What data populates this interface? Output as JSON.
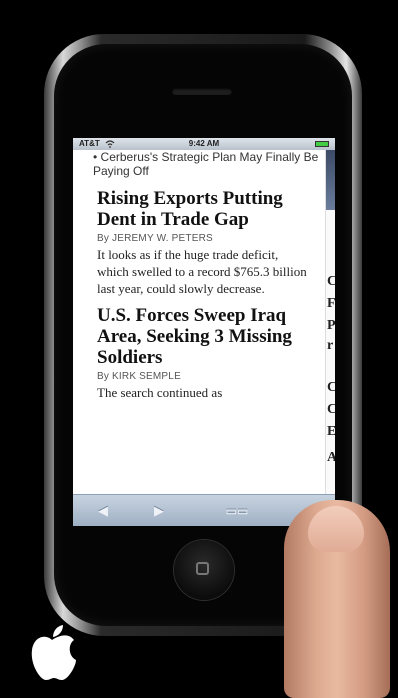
{
  "status_bar": {
    "carrier": "AT&T",
    "time": "9:42 AM"
  },
  "article_list": {
    "previous_link": "• Cerberus's Strategic Plan May Finally Be Paying Off",
    "articles": [
      {
        "headline": "Rising Exports Putting Dent in Trade Gap",
        "byline": "By JEREMY W. PETERS",
        "summary": "It looks as if the huge trade deficit, which swelled to a record $765.3 billion last year, could slowly decrease."
      },
      {
        "headline": "U.S. Forces Sweep Iraq Area, Seeking 3 Missing Soldiers",
        "byline": "By KIRK SEMPLE",
        "summary": "The search continued as"
      }
    ]
  },
  "side_column": {
    "letters": [
      "C",
      "F",
      "P",
      "r",
      "C",
      "C",
      "E",
      "A"
    ]
  },
  "toolbar": {
    "back_icon": "◀",
    "forward_icon": "▶",
    "bookmarks_icon": "▭▭"
  },
  "icons": {
    "wifi": "wifi-icon",
    "battery": "battery-icon",
    "apple_logo": "apple-logo-icon"
  },
  "colors": {
    "toolbar": "#a9b9cc",
    "status_bar": "#c9d1da",
    "screen_bg": "#ffffff",
    "text": "#111111"
  }
}
